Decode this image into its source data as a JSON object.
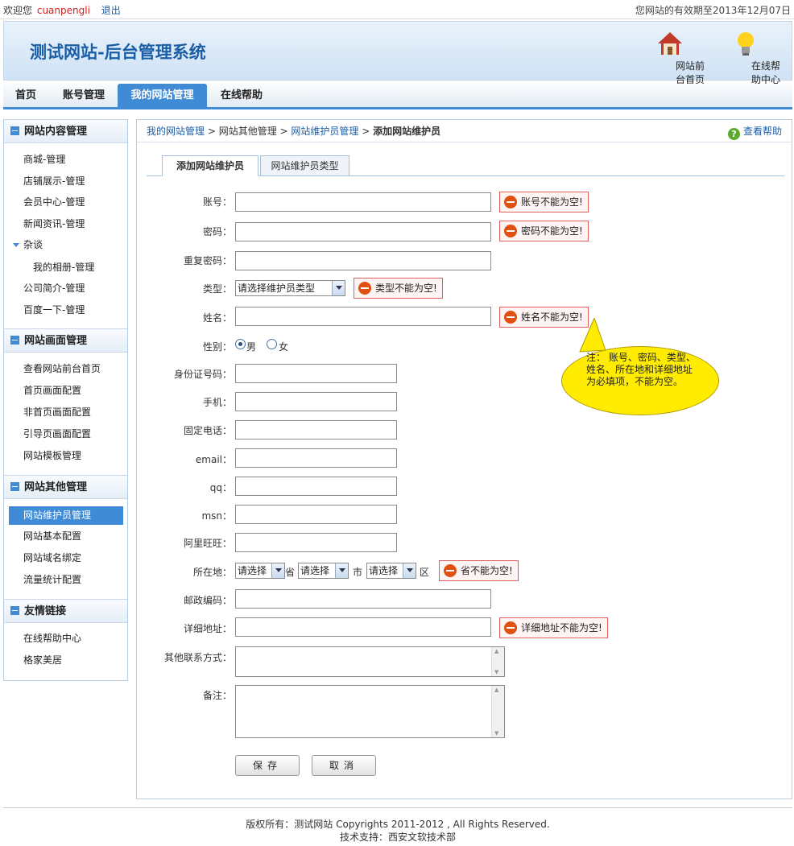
{
  "topbar": {
    "welcome": "欢迎您",
    "username": "cuanpengli",
    "logout": "退出",
    "expiry": "您网站的有效期至2013年12月07日"
  },
  "header": {
    "title": "测试网站-后台管理系统",
    "home_link": "网站前台首页",
    "help_link": "在线帮助中心",
    "home_icon": "house-icon",
    "help_icon": "lightbulb-icon"
  },
  "nav": {
    "items": [
      "首页",
      "账号管理",
      "我的网站管理",
      "在线帮助"
    ],
    "active": "我的网站管理"
  },
  "sidebar": {
    "sections": [
      {
        "title": "网站内容管理",
        "items": [
          "商城-管理",
          "店铺展示-管理",
          "会员中心-管理",
          "新闻资讯-管理",
          "杂谈",
          "我的相册-管理",
          "公司简介-管理",
          "百度一下-管理"
        ]
      },
      {
        "title": "网站画面管理",
        "items": [
          "查看网站前台首页",
          "首页画面配置",
          "非首页画面配置",
          "引导页画面配置",
          "网站模板管理"
        ]
      },
      {
        "title": "网站其他管理",
        "items": [
          "网站维护员管理",
          "网站基本配置",
          "网站域名绑定",
          "流量统计配置"
        ]
      },
      {
        "title": "友情链接",
        "items": [
          "在线帮助中心",
          "格家美居"
        ]
      }
    ]
  },
  "breadcrumb": {
    "c1": "我的网站管理",
    "c2": "网站其他管理",
    "c3": "网站维护员管理",
    "current": "添加网站维护员",
    "sep": " > ",
    "help": "查看帮助"
  },
  "tabs": [
    "添加网站维护员",
    "网站维护员类型"
  ],
  "form": {
    "account": "账号：",
    "password": "密码：",
    "repeat_password": "重复密码：",
    "type": "类型：",
    "type_placeholder": "请选择维护员类型",
    "name": "姓名：",
    "gender": "性别：",
    "male": "男",
    "female": "女",
    "id_card": "身份证号码：",
    "mobile": "手机：",
    "phone": "固定电话：",
    "email": "email：",
    "qq": "qq：",
    "msn": "msn：",
    "aliwangwang": "阿里旺旺：",
    "location": "所在地：",
    "select": "请选择",
    "province": "省",
    "city": "市",
    "district": "区",
    "postcode": "邮政编码：",
    "address": "详细地址：",
    "other_contact": "其他联系方式：",
    "remark": "备注：",
    "save": "保存",
    "cancel": "取消",
    "gender_selected": "男"
  },
  "errors": {
    "account": "账号不能为空!",
    "password": "密码不能为空!",
    "type": "类型不能为空!",
    "name": "姓名不能为空!",
    "location": "省不能为空!",
    "address": "详细地址不能为空!"
  },
  "note": "注： 账号、密码、类型、姓名、所在地和详细地址为必填项，不能为空。",
  "footer": {
    "copyright": "版权所有：测试网站 Copyrights 2011-2012 , All Rights Reserved.",
    "support": "技术支持：西安文软技术部"
  },
  "colors": {
    "accent": "#3f8bd6",
    "error_border": "#e06060",
    "note_bg": "#ffec00"
  }
}
